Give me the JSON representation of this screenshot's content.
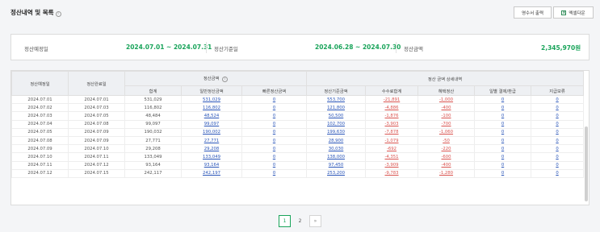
{
  "header": {
    "title": "정산내역 및 목록",
    "print_label": "영수서 출력",
    "excel_label": "엑셀다운"
  },
  "summary": {
    "settle_date_label": "정산예정일",
    "settle_date_value": "2024.07.01 ~ 2024.07.31",
    "base_date_label": "정산기준일",
    "base_date_value": "2024.06.28 ~ 2024.07.30",
    "amount_label": "정산금액",
    "amount_value": "2,345,970원"
  },
  "table": {
    "headers": {
      "scheduled_date": "정산예정일",
      "completed_date": "정산완료일",
      "settle_amount_group": "정산금액",
      "detail_group": "정산 금액 상세내역",
      "total": "합계",
      "normal": "일반정산금액",
      "fast": "빠른정산금액",
      "base_amount": "정산기준금액",
      "fee_total": "수수료합계",
      "benefit": "혜택정산",
      "payment": "일별 결제/환급",
      "hold": "지급보류"
    },
    "rows": [
      [
        "2024.07.01",
        "2024.07.01",
        "531,029",
        "531,029",
        "0",
        "553,700",
        "-21,891",
        "-1,000",
        "0",
        "0"
      ],
      [
        "2024.07.02",
        "2024.07.03",
        "116,802",
        "116,802",
        "0",
        "121,800",
        "-4,886",
        "-400",
        "0",
        "0"
      ],
      [
        "2024.07.03",
        "2024.07.05",
        "48,484",
        "48,524",
        "0",
        "50,500",
        "-1,876",
        "-100",
        "0",
        "0"
      ],
      [
        "2024.07.04",
        "2024.07.08",
        "99,097",
        "99,097",
        "0",
        "102,700",
        "-3,903",
        "-700",
        "0",
        "0"
      ],
      [
        "2024.07.05",
        "2024.07.09",
        "190,032",
        "190,002",
        "0",
        "199,630",
        "-7,878",
        "-1,060",
        "0",
        "0"
      ],
      [
        "2024.07.08",
        "2024.07.09",
        "27,771",
        "27,771",
        "0",
        "28,900",
        "-1,079",
        "-50",
        "0",
        "0"
      ],
      [
        "2024.07.09",
        "2024.07.10",
        "29,208",
        "29,208",
        "0",
        "30,030",
        "-692",
        "-220",
        "0",
        "0"
      ],
      [
        "2024.07.10",
        "2024.07.11",
        "133,049",
        "133,049",
        "0",
        "138,000",
        "-4,351",
        "-600",
        "0",
        "0"
      ],
      [
        "2024.07.11",
        "2024.07.12",
        "93,164",
        "93,164",
        "0",
        "97,450",
        "-3,909",
        "-400",
        "0",
        "0"
      ],
      [
        "2024.07.12",
        "2024.07.15",
        "242,117",
        "242,197",
        "0",
        "253,200",
        "-9,783",
        "-1,280",
        "0",
        "0"
      ]
    ]
  },
  "pagination": {
    "pages": [
      "1",
      "2"
    ],
    "next": "»",
    "current": "1"
  },
  "colors": {
    "accent_green": "#19a45a",
    "link_blue": "#2a55b8",
    "negative_red": "#d9534f"
  }
}
